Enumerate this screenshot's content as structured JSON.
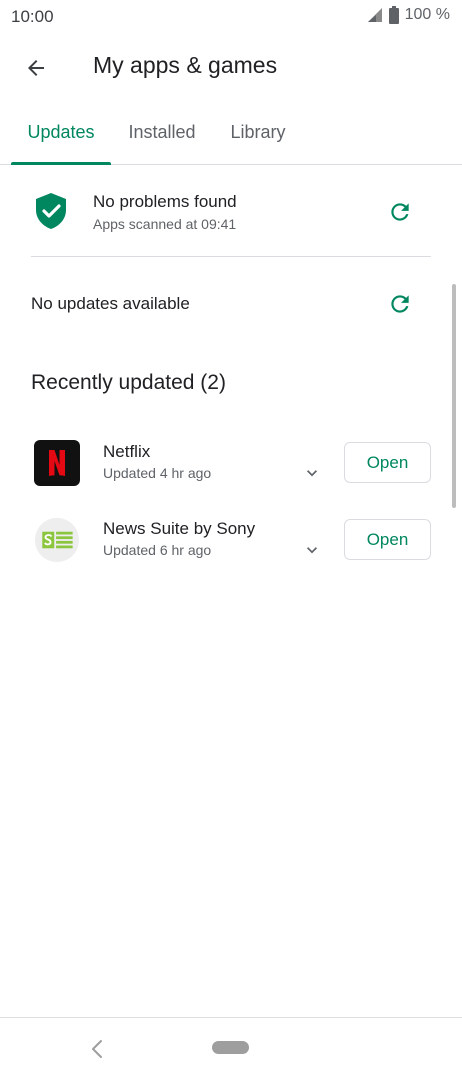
{
  "status_bar": {
    "time": "10:00",
    "battery": "100 %"
  },
  "header": {
    "title": "My apps & games"
  },
  "tabs": [
    {
      "label": "Updates",
      "active": true
    },
    {
      "label": "Installed",
      "active": false
    },
    {
      "label": "Library",
      "active": false
    }
  ],
  "scan": {
    "title": "No problems found",
    "subtitle": "Apps scanned at 09:41"
  },
  "updates": {
    "message": "No updates available"
  },
  "recent": {
    "title": "Recently updated (2)",
    "apps": [
      {
        "name": "Netflix",
        "subtitle": "Updated 4 hr ago",
        "action": "Open"
      },
      {
        "name": "News Suite by Sony",
        "subtitle": "Updated 6 hr ago",
        "action": "Open"
      }
    ]
  },
  "colors": {
    "accent": "#01875f",
    "netflix_red": "#e50914",
    "sony_green": "#8cc63f"
  },
  "icons": {
    "status": [
      "signal-icon",
      "battery-icon"
    ],
    "header": "back-arrow-icon",
    "scan": "shield-check-icon",
    "refresh": "refresh-icon",
    "expand": "chevron-down-icon",
    "nav": [
      "nav-back-icon",
      "nav-home-pill"
    ]
  }
}
